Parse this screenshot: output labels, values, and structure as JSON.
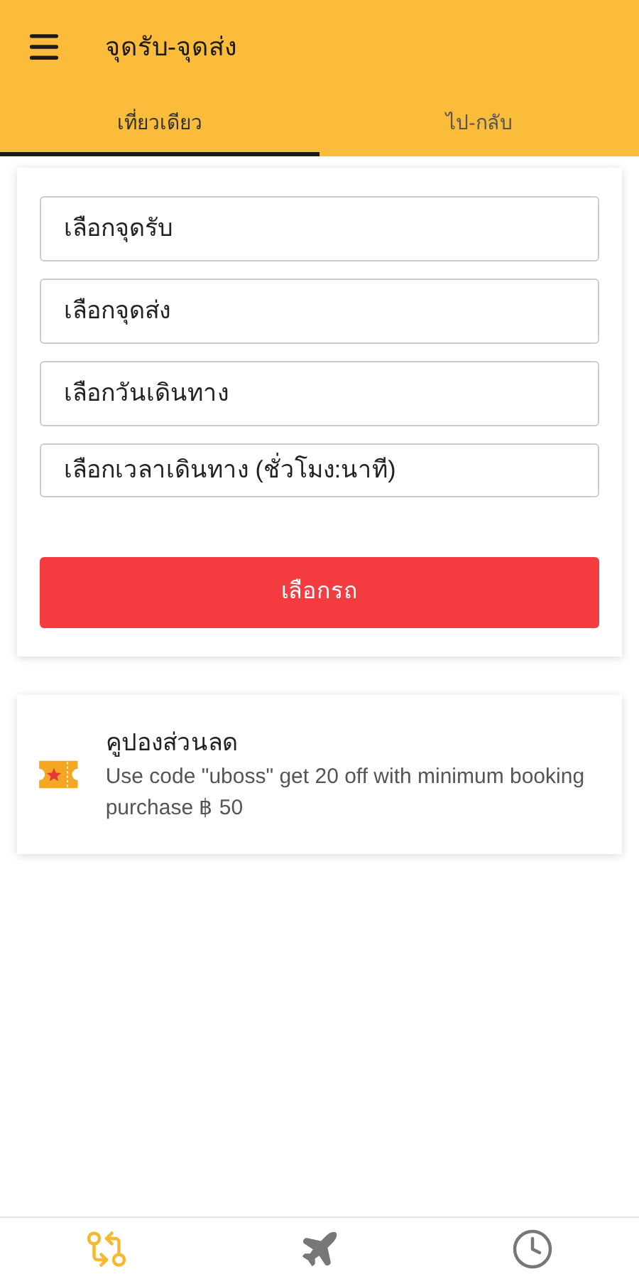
{
  "header": {
    "title": "จุดรับ-จุดส่ง"
  },
  "tabs": [
    {
      "label": "เที่ยวเดียว",
      "selected": true
    },
    {
      "label": "ไป-กลับ",
      "selected": false
    }
  ],
  "form": {
    "fields": [
      {
        "placeholder": "เลือกจุดรับ"
      },
      {
        "placeholder": "เลือกจุดส่ง"
      },
      {
        "placeholder": "เลือกวันเดินทาง"
      },
      {
        "placeholder": "เลือกเวลาเดินทาง (ชั่วโมง:นาที)"
      }
    ],
    "button": "เลือกรถ"
  },
  "coupon": {
    "title": "คูปองส่วนลด",
    "text": "Use code \"uboss\" get 20 off with minimum booking purchase ฿ 50"
  },
  "bottom_nav": [
    {
      "kind": "route",
      "selected": true
    },
    {
      "kind": "flight",
      "selected": false
    },
    {
      "kind": "history",
      "selected": false
    }
  ]
}
